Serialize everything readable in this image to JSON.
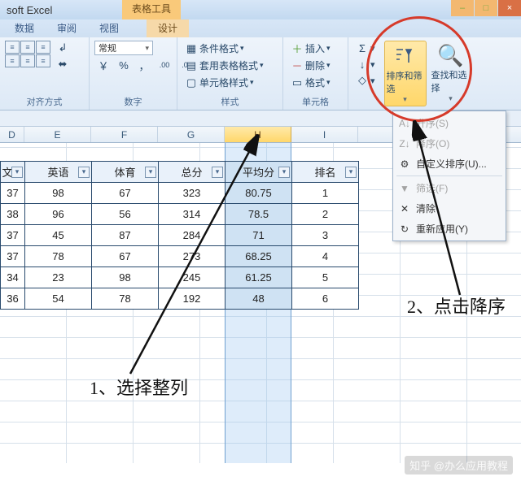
{
  "title": "soft Excel",
  "tab_tools": "表格工具",
  "ribbon_tabs": {
    "data": "数据",
    "review": "审阅",
    "view": "视图",
    "design": "设计"
  },
  "groups": {
    "alignment": {
      "label": "对齐方式"
    },
    "number": {
      "label": "数字",
      "format_value": "常规",
      "comma": "，",
      "percent": "%",
      "inc": ".0→.00",
      "dec": ".00→.0"
    },
    "styles": {
      "label": "样式",
      "cond": "条件格式",
      "table": "套用表格格式",
      "cell": "单元格样式"
    },
    "cells": {
      "label": "单元格",
      "insert": "插入",
      "delete": "删除",
      "format": "格式"
    },
    "editing": {
      "sigma": "Σ",
      "fill": "↓",
      "clear": "◇",
      "sort_filter": "排序和筛选",
      "find_select": "查找和选择"
    }
  },
  "dropdown": {
    "asc": "升序(S)",
    "desc": "降序(O)",
    "custom": "自定义排序(U)...",
    "filter": "筛选(F)",
    "clear": "清除",
    "reapply": "重新应用(Y)"
  },
  "columns": {
    "D": "D",
    "E": "E",
    "F": "F",
    "G": "G",
    "H": "H",
    "I": "I"
  },
  "headers": {
    "D": "文学",
    "E": "英语",
    "F": "体育",
    "G": "总分",
    "H": "平均分",
    "I": "排名"
  },
  "rows": [
    {
      "D": "37",
      "E": "98",
      "F": "67",
      "G": "323",
      "H": "80.75",
      "I": "1"
    },
    {
      "D": "38",
      "E": "96",
      "F": "56",
      "G": "314",
      "H": "78.5",
      "I": "2"
    },
    {
      "D": "37",
      "E": "45",
      "F": "87",
      "G": "284",
      "H": "71",
      "I": "3"
    },
    {
      "D": "37",
      "E": "78",
      "F": "67",
      "G": "273",
      "H": "68.25",
      "I": "4"
    },
    {
      "D": "34",
      "E": "23",
      "F": "98",
      "G": "245",
      "H": "61.25",
      "I": "5"
    },
    {
      "D": "36",
      "E": "54",
      "F": "78",
      "G": "192",
      "H": "48",
      "I": "6"
    }
  ],
  "annotations": {
    "one": "1、选择整列",
    "two": "2、点击降序"
  },
  "watermark": "知乎 @办么应用教程"
}
